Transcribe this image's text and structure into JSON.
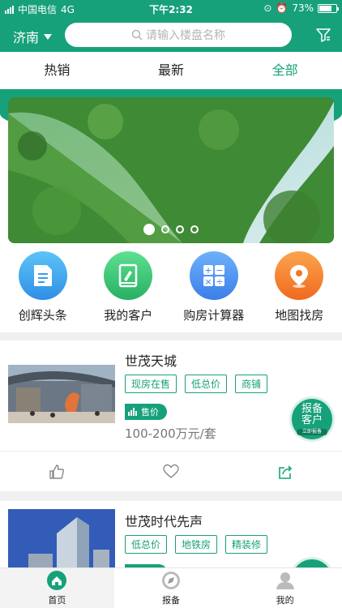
{
  "status": {
    "carrier": "中国电信",
    "network": "4G",
    "time": "下午2:32",
    "battery": "73%"
  },
  "header": {
    "city": "济南",
    "search_placeholder": "请输入楼盘名称"
  },
  "tabs": [
    {
      "label": "热销"
    },
    {
      "label": "最新"
    },
    {
      "label": "全部"
    }
  ],
  "quick": [
    {
      "label": "创辉头条",
      "icon": "document-icon",
      "color": "#2fa3ee"
    },
    {
      "label": "我的客户",
      "icon": "book-icon",
      "color": "#3cc47c"
    },
    {
      "label": "购房计算器",
      "icon": "calculator-icon",
      "color": "#3f8ff2"
    },
    {
      "label": "地图找房",
      "icon": "location-pin-icon",
      "color": "#f5822a"
    }
  ],
  "listings": [
    {
      "title": "世茂天城",
      "tags": [
        "现房在售",
        "低总价",
        "商铺"
      ],
      "price_badge": "售价",
      "price": "100-200万元/套",
      "report_line1": "报备",
      "report_line2": "客户",
      "report_small": "立即报备"
    },
    {
      "title": "世茂时代先声",
      "tags": [
        "低总价",
        "地铁房",
        "精装修"
      ]
    }
  ],
  "bottom_nav": [
    {
      "label": "首页"
    },
    {
      "label": "报备"
    },
    {
      "label": "我的"
    }
  ],
  "colors": {
    "accent": "#17a17a"
  }
}
